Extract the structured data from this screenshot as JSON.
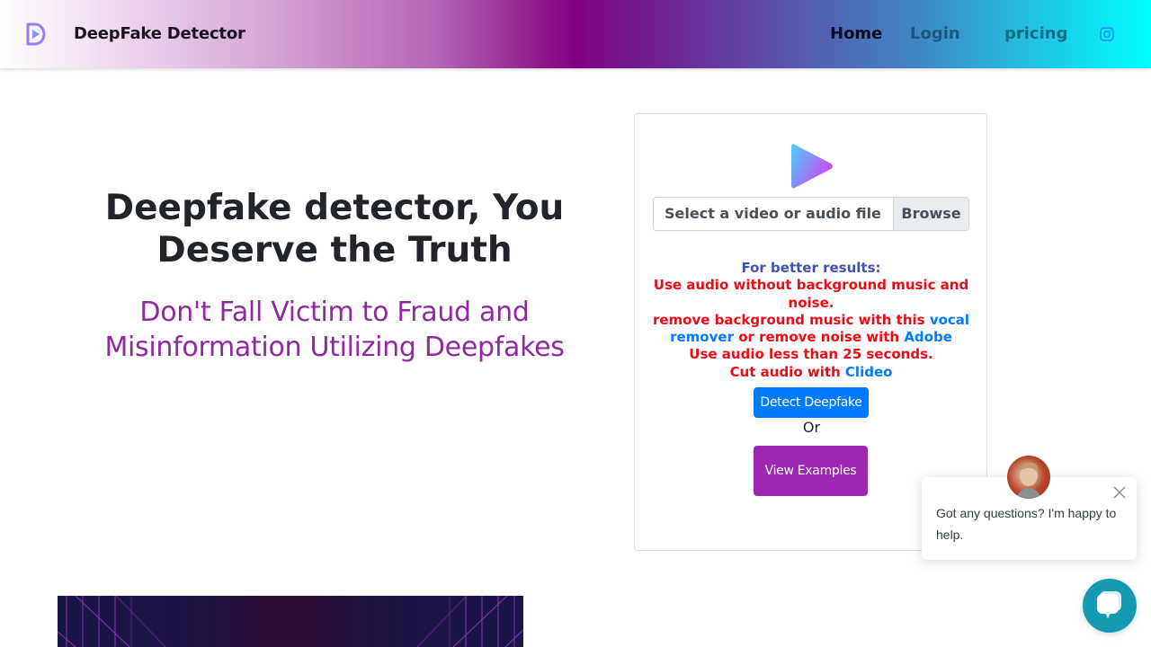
{
  "navbar": {
    "brand_name": "DeepFake Detector",
    "links": [
      {
        "label": "Home"
      },
      {
        "label": "Login"
      },
      {
        "label": "pricing"
      }
    ],
    "social_icon": "instagram-icon",
    "gradient_colors": [
      "#ffffff",
      "#800080",
      "#00ffff"
    ]
  },
  "hero": {
    "title": "Deepfake detector, You Deserve the Truth",
    "subtitle": "Don't Fall Victim to Fraud and Misinformation Utilizing Deepfakes"
  },
  "upload": {
    "icon": "play-icon",
    "file_placeholder": "Select a video or audio file",
    "browse_label": "Browse",
    "tips": {
      "heading": "For better results:",
      "line1": "Use audio without background music and noise.",
      "line2_prefix": "remove background music with this ",
      "link_vocal_remover": "vocal remover",
      "line2_middle": " or remove noise with ",
      "link_adobe": "Adobe",
      "line3": "Use audio less than 25 seconds.",
      "line4_prefix": "Cut audio with ",
      "link_clideo": "Clideo"
    },
    "detect_button": "Detect Deepfake",
    "or_text": "Or",
    "examples_button": "View Examples"
  },
  "chat": {
    "message": "Got any questions? I'm happy to help.",
    "close_icon": "close-icon",
    "launcher_icon": "chat-bubble-icon"
  },
  "colors": {
    "primary": "#007bff",
    "secondary": "#9c27b0",
    "warning_text": "#f00a14",
    "tips_heading": "#3f51b5",
    "subtitle": "#9028a0",
    "chat_launcher": "#149bb3"
  }
}
